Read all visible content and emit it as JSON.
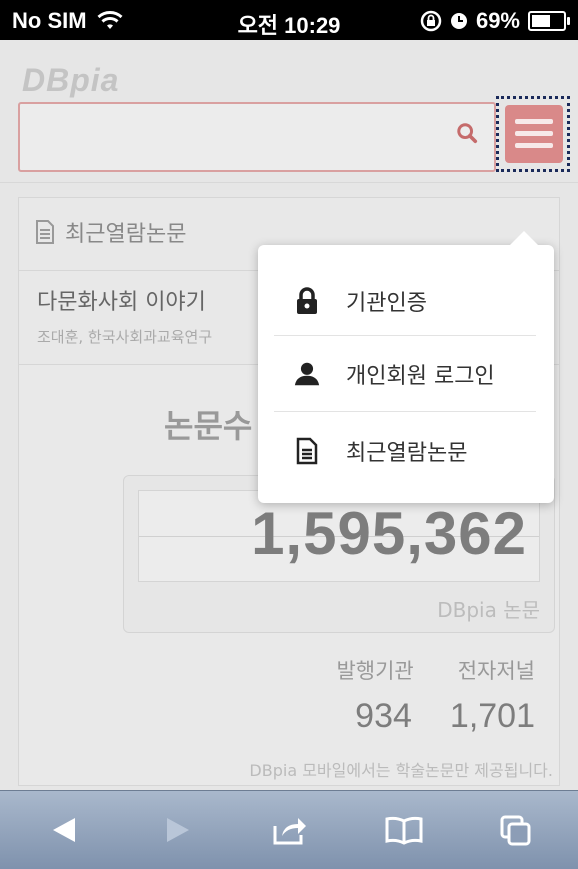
{
  "status_bar": {
    "carrier": "No SIM",
    "time": "오전 10:29",
    "battery_percent": "69%",
    "battery_level": 0.69
  },
  "header": {
    "logo": "DBpia",
    "search": {
      "value": "",
      "placeholder": ""
    },
    "icons": {
      "search": "search-icon",
      "menu": "hamburger-menu-icon"
    }
  },
  "recent": {
    "heading": "최근열람논문",
    "item_title": "다문화사회 이야기",
    "item_meta": "조대훈, 한국사회과교육연구"
  },
  "stats": {
    "title": "논문수",
    "total_count": "1,595,362",
    "total_label": "DBpia 논문",
    "publishers_label": "발행기관",
    "publishers_value": "934",
    "journals_label": "전자저널",
    "journals_value": "1,701",
    "note": "DBpia 모바일에서는 학술논문만 제공됩니다."
  },
  "dropdown_menu": {
    "items": [
      {
        "label": "기관인증",
        "icon": "lock-icon"
      },
      {
        "label": "개인회원 로그인",
        "icon": "user-icon"
      },
      {
        "label": "최근열람논문",
        "icon": "document-icon"
      }
    ]
  },
  "toolbar": {
    "icons": [
      "back-icon",
      "forward-icon",
      "share-icon",
      "bookmarks-icon",
      "tabs-icon"
    ]
  },
  "colors": {
    "accent": "#d98989",
    "search_border": "#d9a0a0",
    "toolbar_top": "#a9b8cc",
    "toolbar_bottom": "#7f92ad"
  }
}
